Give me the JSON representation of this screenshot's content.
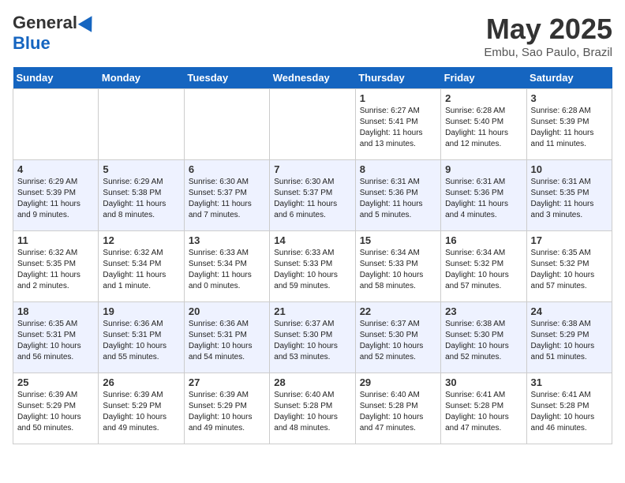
{
  "logo": {
    "general": "General",
    "blue": "Blue"
  },
  "title": "May 2025",
  "location": "Embu, Sao Paulo, Brazil",
  "days_of_week": [
    "Sunday",
    "Monday",
    "Tuesday",
    "Wednesday",
    "Thursday",
    "Friday",
    "Saturday"
  ],
  "weeks": [
    [
      {
        "day": "",
        "info": ""
      },
      {
        "day": "",
        "info": ""
      },
      {
        "day": "",
        "info": ""
      },
      {
        "day": "",
        "info": ""
      },
      {
        "day": "1",
        "info": "Sunrise: 6:27 AM\nSunset: 5:41 PM\nDaylight: 11 hours and 13 minutes."
      },
      {
        "day": "2",
        "info": "Sunrise: 6:28 AM\nSunset: 5:40 PM\nDaylight: 11 hours and 12 minutes."
      },
      {
        "day": "3",
        "info": "Sunrise: 6:28 AM\nSunset: 5:39 PM\nDaylight: 11 hours and 11 minutes."
      }
    ],
    [
      {
        "day": "4",
        "info": "Sunrise: 6:29 AM\nSunset: 5:39 PM\nDaylight: 11 hours and 9 minutes."
      },
      {
        "day": "5",
        "info": "Sunrise: 6:29 AM\nSunset: 5:38 PM\nDaylight: 11 hours and 8 minutes."
      },
      {
        "day": "6",
        "info": "Sunrise: 6:30 AM\nSunset: 5:37 PM\nDaylight: 11 hours and 7 minutes."
      },
      {
        "day": "7",
        "info": "Sunrise: 6:30 AM\nSunset: 5:37 PM\nDaylight: 11 hours and 6 minutes."
      },
      {
        "day": "8",
        "info": "Sunrise: 6:31 AM\nSunset: 5:36 PM\nDaylight: 11 hours and 5 minutes."
      },
      {
        "day": "9",
        "info": "Sunrise: 6:31 AM\nSunset: 5:36 PM\nDaylight: 11 hours and 4 minutes."
      },
      {
        "day": "10",
        "info": "Sunrise: 6:31 AM\nSunset: 5:35 PM\nDaylight: 11 hours and 3 minutes."
      }
    ],
    [
      {
        "day": "11",
        "info": "Sunrise: 6:32 AM\nSunset: 5:35 PM\nDaylight: 11 hours and 2 minutes."
      },
      {
        "day": "12",
        "info": "Sunrise: 6:32 AM\nSunset: 5:34 PM\nDaylight: 11 hours and 1 minute."
      },
      {
        "day": "13",
        "info": "Sunrise: 6:33 AM\nSunset: 5:34 PM\nDaylight: 11 hours and 0 minutes."
      },
      {
        "day": "14",
        "info": "Sunrise: 6:33 AM\nSunset: 5:33 PM\nDaylight: 10 hours and 59 minutes."
      },
      {
        "day": "15",
        "info": "Sunrise: 6:34 AM\nSunset: 5:33 PM\nDaylight: 10 hours and 58 minutes."
      },
      {
        "day": "16",
        "info": "Sunrise: 6:34 AM\nSunset: 5:32 PM\nDaylight: 10 hours and 57 minutes."
      },
      {
        "day": "17",
        "info": "Sunrise: 6:35 AM\nSunset: 5:32 PM\nDaylight: 10 hours and 57 minutes."
      }
    ],
    [
      {
        "day": "18",
        "info": "Sunrise: 6:35 AM\nSunset: 5:31 PM\nDaylight: 10 hours and 56 minutes."
      },
      {
        "day": "19",
        "info": "Sunrise: 6:36 AM\nSunset: 5:31 PM\nDaylight: 10 hours and 55 minutes."
      },
      {
        "day": "20",
        "info": "Sunrise: 6:36 AM\nSunset: 5:31 PM\nDaylight: 10 hours and 54 minutes."
      },
      {
        "day": "21",
        "info": "Sunrise: 6:37 AM\nSunset: 5:30 PM\nDaylight: 10 hours and 53 minutes."
      },
      {
        "day": "22",
        "info": "Sunrise: 6:37 AM\nSunset: 5:30 PM\nDaylight: 10 hours and 52 minutes."
      },
      {
        "day": "23",
        "info": "Sunrise: 6:38 AM\nSunset: 5:30 PM\nDaylight: 10 hours and 52 minutes."
      },
      {
        "day": "24",
        "info": "Sunrise: 6:38 AM\nSunset: 5:29 PM\nDaylight: 10 hours and 51 minutes."
      }
    ],
    [
      {
        "day": "25",
        "info": "Sunrise: 6:39 AM\nSunset: 5:29 PM\nDaylight: 10 hours and 50 minutes."
      },
      {
        "day": "26",
        "info": "Sunrise: 6:39 AM\nSunset: 5:29 PM\nDaylight: 10 hours and 49 minutes."
      },
      {
        "day": "27",
        "info": "Sunrise: 6:39 AM\nSunset: 5:29 PM\nDaylight: 10 hours and 49 minutes."
      },
      {
        "day": "28",
        "info": "Sunrise: 6:40 AM\nSunset: 5:28 PM\nDaylight: 10 hours and 48 minutes."
      },
      {
        "day": "29",
        "info": "Sunrise: 6:40 AM\nSunset: 5:28 PM\nDaylight: 10 hours and 47 minutes."
      },
      {
        "day": "30",
        "info": "Sunrise: 6:41 AM\nSunset: 5:28 PM\nDaylight: 10 hours and 47 minutes."
      },
      {
        "day": "31",
        "info": "Sunrise: 6:41 AM\nSunset: 5:28 PM\nDaylight: 10 hours and 46 minutes."
      }
    ]
  ]
}
